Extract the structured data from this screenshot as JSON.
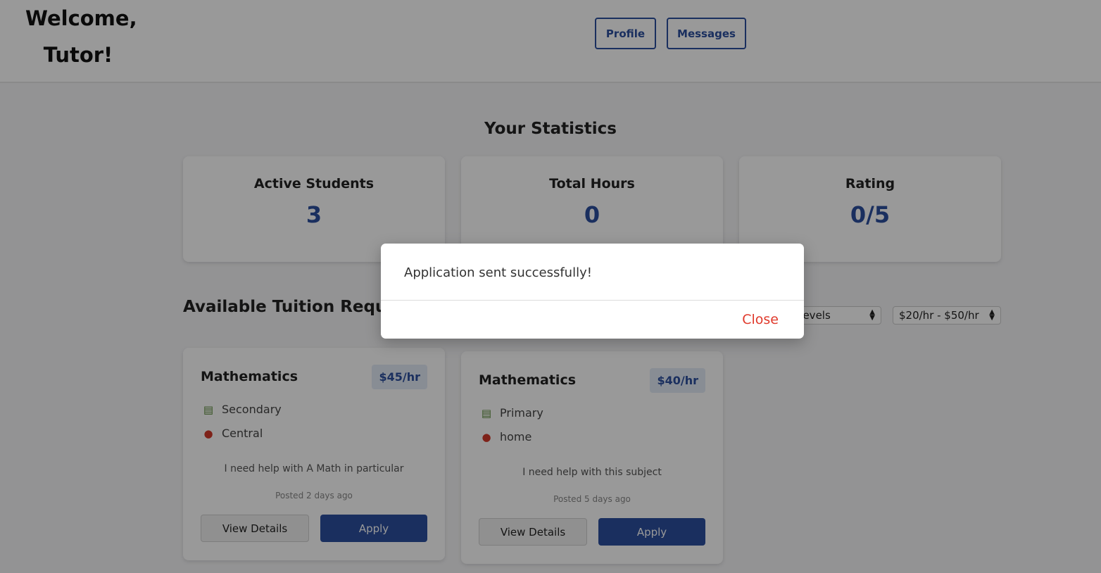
{
  "header": {
    "welcome_line1": "Welcome,",
    "welcome_line2": "Tutor!",
    "profile_label": "Profile",
    "messages_label": "Messages"
  },
  "stats": {
    "title": "Your Statistics",
    "items": [
      {
        "label": "Active Students",
        "value": "3"
      },
      {
        "label": "Total Hours",
        "value": "0"
      },
      {
        "label": "Rating",
        "value": "0/5"
      }
    ]
  },
  "requests": {
    "title": "Available Tuition Requests",
    "filters": {
      "level_value": "All Levels",
      "rate_value": "$20/hr - $50/hr"
    },
    "items": [
      {
        "subject": "Mathematics",
        "rate": "$45/hr",
        "level": "Secondary",
        "location": "Central",
        "description": "I need help with A Math in particular",
        "posted": "Posted 2 days ago",
        "view_label": "View Details",
        "apply_label": "Apply"
      },
      {
        "subject": "Mathematics",
        "rate": "$40/hr",
        "level": "Primary",
        "location": "home",
        "description": "I need help with this subject",
        "posted": "Posted 5 days ago",
        "view_label": "View Details",
        "apply_label": "Apply"
      }
    ]
  },
  "modal": {
    "message": "Application sent successfully!",
    "close_label": "Close"
  },
  "icons": {
    "level": "books-icon",
    "location": "pin-icon"
  },
  "colors": {
    "accent": "#2c4f9e",
    "close": "#e0392b"
  }
}
